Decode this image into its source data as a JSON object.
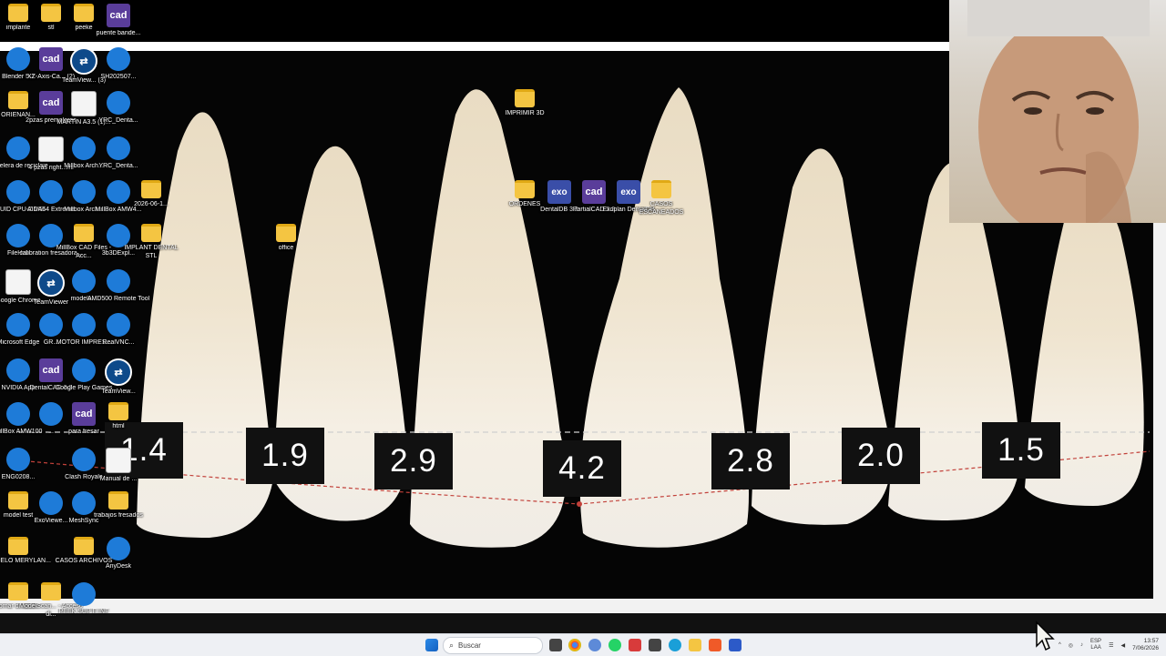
{
  "measurements": [
    "1.4",
    "1.9",
    "2.9",
    "4.2",
    "2.8",
    "2.0",
    "1.5"
  ],
  "desktop_icons": [
    {
      "label": "implante",
      "type": "folder"
    },
    {
      "label": "stl",
      "type": "folder"
    },
    {
      "label": "peeke",
      "type": "folder"
    },
    {
      "label": "puente bande...",
      "type": "cad"
    },
    {
      "label": "Blender 5.1",
      "type": "app"
    },
    {
      "label": "XZ-Axis-Ca... (2)",
      "type": "cad"
    },
    {
      "label": "TeamView... (3)",
      "type": "teamviewer"
    },
    {
      "label": "SH202507...",
      "type": "app"
    },
    {
      "label": "ORIENAN...",
      "type": "folder"
    },
    {
      "label": "2pzas premolares",
      "type": "cad"
    },
    {
      "label": "MARTIN A3.5 (1)...",
      "type": "doc"
    },
    {
      "label": "YRC_Denta...",
      "type": "app"
    },
    {
      "label": "Papelera de reciclaje",
      "type": "app"
    },
    {
      "label": "4 pzas right...ml",
      "type": "doc"
    },
    {
      "label": "Millbox Arch...",
      "type": "app"
    },
    {
      "label": "YRC_Denta...",
      "type": "app"
    },
    {
      "label": "CPUID CPU-Z MSI",
      "type": "app"
    },
    {
      "label": "AIDA64 Extreme",
      "type": "app"
    },
    {
      "label": "Millbox Arch...",
      "type": "app"
    },
    {
      "label": "MillBox AMW4...",
      "type": "app"
    },
    {
      "label": "2026-06-1...",
      "type": "folder"
    },
    {
      "label": "FileHub",
      "type": "app"
    },
    {
      "label": "calibration fresadora...",
      "type": "app"
    },
    {
      "label": "MillBox CAD Files - Acc...",
      "type": "folder"
    },
    {
      "label": "3b3DExpl...",
      "type": "app"
    },
    {
      "label": "IMPLANT DENTAL STL",
      "type": "folder"
    },
    {
      "label": "office",
      "type": "folder"
    },
    {
      "label": "Google Chrome",
      "type": "doc"
    },
    {
      "label": "TeamViewer",
      "type": "teamviewer"
    },
    {
      "label": "modelo...",
      "type": "app"
    },
    {
      "label": "AMD500 Remote Tool",
      "type": "app"
    },
    {
      "label": "Microsoft Edge",
      "type": "app"
    },
    {
      "label": "GR...",
      "type": "app"
    },
    {
      "label": "MOTOR IMPRES...",
      "type": "app"
    },
    {
      "label": "RealVNC...",
      "type": "app"
    },
    {
      "label": "NVIDIA App",
      "type": "app"
    },
    {
      "label": "DentalCAD 3.2",
      "type": "cad"
    },
    {
      "label": "Google Play Games",
      "type": "app"
    },
    {
      "label": "TeamView...",
      "type": "teamviewer"
    },
    {
      "label": "MillBox AMW100",
      "type": "app"
    },
    {
      "label": "...",
      "type": "app"
    },
    {
      "label": "para fresar",
      "type": "cad"
    },
    {
      "label": "html",
      "type": "folder"
    },
    {
      "label": "ENG0208...",
      "type": "app"
    },
    {
      "label": "Clash Royale",
      "type": "app"
    },
    {
      "label": "Manual de ...",
      "type": "doc"
    },
    {
      "label": "model test",
      "type": "folder"
    },
    {
      "label": "ExoViewe...",
      "type": "app"
    },
    {
      "label": "MeshSync",
      "type": "app"
    },
    {
      "label": "trabajos fresados",
      "type": "folder"
    },
    {
      "label": "MODELO MERYLAN...",
      "type": "folder"
    },
    {
      "label": "CASOS ARCHIVOS",
      "type": "folder"
    },
    {
      "label": "AnyDesk",
      "type": "app"
    },
    {
      "label": "omar dr kevin",
      "type": "folder"
    },
    {
      "label": "ModelScan... - Acceso di...",
      "type": "folder"
    },
    {
      "label": "PEEK SUP E INF",
      "type": "app"
    },
    {
      "label": "IMPRIMIR 3D",
      "type": "folder"
    },
    {
      "label": "ORDENES",
      "type": "folder"
    },
    {
      "label": "DentalDB 3.2",
      "type": "exo"
    },
    {
      "label": "PartialCAD 3.3",
      "type": "cad"
    },
    {
      "label": "Exoplan DentalDB",
      "type": "exo"
    },
    {
      "label": "CASOS ESCANEADOS",
      "type": "folder"
    }
  ],
  "taskbar": {
    "search_placeholder": "Buscar",
    "lang_top": "ESP",
    "lang_bottom": "LAA",
    "time": "13:57",
    "date": "7/06/2026"
  },
  "colors": {
    "taskbar_bg": "#eef0f4",
    "viewer_bg": "#050505",
    "measure_box": "#111111",
    "dashed_guide": "#cfcfcf",
    "red_guide": "#c2413a"
  }
}
